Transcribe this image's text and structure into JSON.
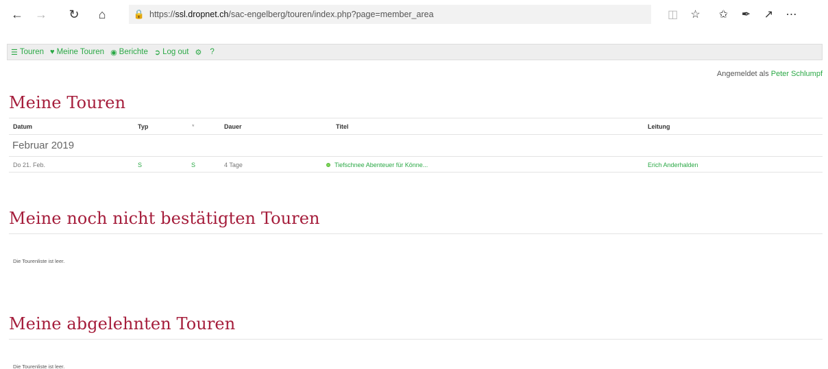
{
  "browser": {
    "url_host": "ssl.dropnet.ch",
    "url_path": "/sac-engelberg/touren/index.php?page=member_area",
    "url_prefix": "https://"
  },
  "menu": {
    "items": [
      {
        "label": "Touren",
        "icon": "list-icon"
      },
      {
        "label": "Meine Touren",
        "icon": "heart-icon"
      },
      {
        "label": "Berichte",
        "icon": "camera-icon"
      },
      {
        "label": "Log out",
        "icon": "logout-icon"
      },
      {
        "label": "",
        "icon": "gear-icon"
      },
      {
        "label": "?",
        "icon": ""
      }
    ]
  },
  "user": {
    "prefix": "Angemeldet als",
    "name": "Peter Schlumpf"
  },
  "sections": {
    "mine": "Meine Touren",
    "pending": "Meine noch nicht bestätigten Touren",
    "rejected": "Meine abgelehnten Touren"
  },
  "table": {
    "headers": {
      "datum": "Datum",
      "typ": "Typ",
      "star": "*",
      "dauer": "Dauer",
      "titel": "Titel",
      "leitung": "Leitung"
    },
    "month": "Februar 2019",
    "rows": [
      {
        "datum": "Do 21. Feb.",
        "typ": "S",
        "star": "S",
        "dauer": "4 Tage",
        "titel": "Tiefschnee Abenteuer für Könne...",
        "leitung": "Erich Anderhalden"
      }
    ]
  },
  "empty_msg": {
    "pending": "Die Tourenliste ist leer.",
    "rejected": "Die Tourenliste ist leer."
  },
  "colors": {
    "accent": "#2aa845",
    "heading": "#a51d3b"
  }
}
